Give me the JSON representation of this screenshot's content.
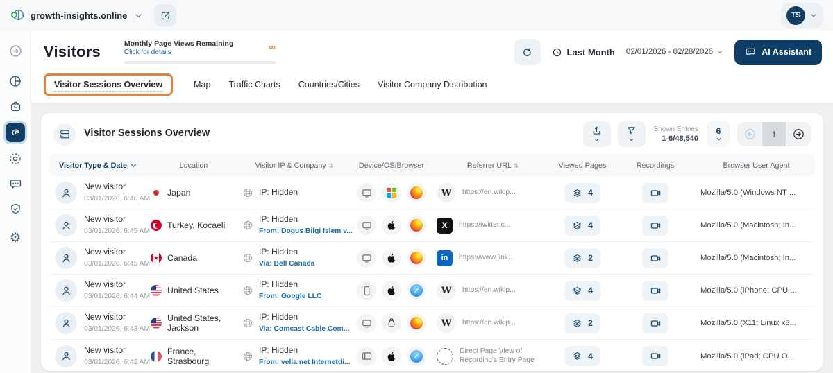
{
  "topbar": {
    "site": "growth-insights.online",
    "avatar": "TS"
  },
  "header": {
    "title": "Visitors",
    "quota_label": "Monthly Page Views Remaining",
    "quota_link": "Click for details",
    "quota_infinity": "∞",
    "period": "Last Month",
    "date_range": "02/01/2026 - 02/28/2026",
    "ai_assistant": "AI Assistant"
  },
  "tabs": [
    {
      "label": "Visitor Sessions Overview",
      "active": true
    },
    {
      "label": "Map"
    },
    {
      "label": "Traffic Charts"
    },
    {
      "label": "Countries/Cities"
    },
    {
      "label": "Visitor Company Distribution"
    }
  ],
  "table": {
    "title": "Visitor Sessions Overview",
    "shown_entries_label": "Shown Entries",
    "shown_entries_value": "1-6/48,540",
    "page_size": "6",
    "current_page": "1",
    "columns": [
      "Visitor Type & Date",
      "Location",
      "Visitor IP & Company",
      "Device/OS/Browser",
      "Referrer URL",
      "Viewed Pages",
      "Recordings",
      "Browser User Agent"
    ],
    "icons": {
      "wikipedia_glyph": "W",
      "x_glyph": "X",
      "linkedin_glyph": "in"
    },
    "rows": [
      {
        "type": "New visitor",
        "date": "03/01/2026, 6:46 AM",
        "location": "Japan",
        "flag": "japan",
        "ip": "IP: Hidden",
        "company": "",
        "device": "desktop",
        "os": "windows",
        "browser": "firefox",
        "referrer_icon": "wikipedia",
        "referrer": "https://en.wikip...",
        "pages": "4",
        "user_agent": "Mozilla/5.0 (Windows NT ..."
      },
      {
        "type": "New visitor",
        "date": "03/01/2026, 6:45 AM",
        "location": "Turkey, Kocaeli",
        "flag": "turkey",
        "ip": "IP: Hidden",
        "company": "From: Dogus Bilgi Islem v...",
        "device": "desktop",
        "os": "apple",
        "browser": "firefox",
        "referrer_icon": "x",
        "referrer": "https://twitter.c...",
        "pages": "4",
        "user_agent": "Mozilla/5.0 (Macintosh; In..."
      },
      {
        "type": "New visitor",
        "date": "03/01/2026, 6:45 AM",
        "location": "Canada",
        "flag": "canada",
        "ip": "IP: Hidden",
        "company": "Via: Bell Canada",
        "device": "desktop",
        "os": "apple",
        "browser": "firefox",
        "referrer_icon": "linkedin",
        "referrer": "https://www.link...",
        "pages": "2",
        "user_agent": "Mozilla/5.0 (Macintosh; In..."
      },
      {
        "type": "New visitor",
        "date": "03/01/2026, 6:44 AM",
        "location": "United States",
        "flag": "us",
        "ip": "IP: Hidden",
        "company": "From: Google LLC",
        "device": "phone",
        "os": "apple",
        "browser": "safari",
        "referrer_icon": "wikipedia",
        "referrer": "https://en.wikip...",
        "pages": "4",
        "user_agent": "Mozilla/5.0 (iPhone; CPU ..."
      },
      {
        "type": "New visitor",
        "date": "03/01/2026, 6:43 AM",
        "location": "United States, Jackson",
        "flag": "us",
        "ip": "IP: Hidden",
        "company": "Via: Comcast Cable Com...",
        "device": "desktop",
        "os": "linux",
        "browser": "firefox",
        "referrer_icon": "wikipedia",
        "referrer": "https://en.wikip...",
        "pages": "2",
        "user_agent": "Mozilla/5.0 (X11; Linux x8..."
      },
      {
        "type": "New visitor",
        "date": "03/01/2026, 6:42 AM",
        "location": "France, Strasbourg",
        "flag": "france",
        "ip": "IP: Hidden",
        "company": "From: velia.net Internetdi...",
        "device": "tablet",
        "os": "apple",
        "browser": "safari",
        "referrer_icon": "direct",
        "referrer": "Direct Page View of Recording's Entry Page",
        "pages": "4",
        "user_agent": "Mozilla/5.0 (iPad; CPU O..."
      }
    ]
  }
}
